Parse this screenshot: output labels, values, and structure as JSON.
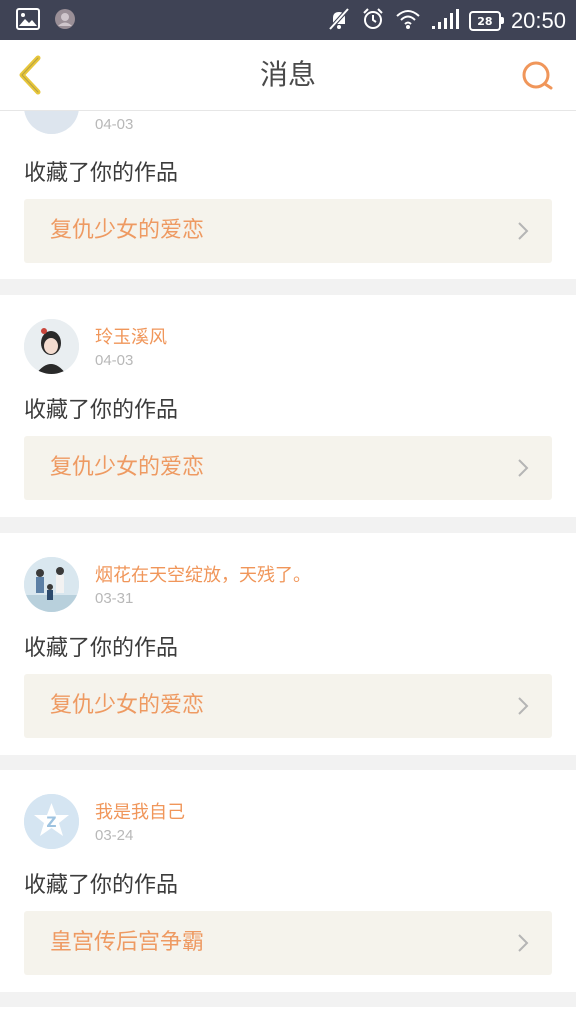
{
  "status_bar": {
    "time": "20:50",
    "battery": "28"
  },
  "header": {
    "title": "消息"
  },
  "messages": [
    {
      "username": "",
      "date": "04-03",
      "action": "收藏了你的作品",
      "work_title": "复仇少女的爱恋"
    },
    {
      "username": "玲玉溪风",
      "date": "04-03",
      "action": "收藏了你的作品",
      "work_title": "复仇少女的爱恋"
    },
    {
      "username": "烟花在天空绽放，天残了。",
      "date": "03-31",
      "action": "收藏了你的作品",
      "work_title": "复仇少女的爱恋"
    },
    {
      "username": "我是我自己",
      "date": "03-24",
      "action": "收藏了你的作品",
      "work_title": "皇宫传后宫争霸"
    }
  ],
  "colors": {
    "status_bar": "#3f4355",
    "accent": "#f0965a",
    "link_bg": "#f5f3ec",
    "back_arrow": "#e7c63a"
  }
}
